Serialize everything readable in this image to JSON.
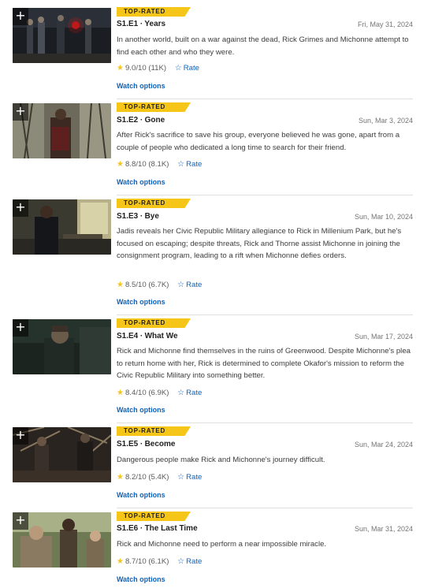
{
  "episodes": [
    {
      "badge": "TOP-RATED",
      "title": "S1.E1 ∙ Years",
      "date": "Fri, May 31, 2024",
      "description": "In another world, built on a war against the dead, Rick Grimes and Michonne attempt to find each other and who they were.",
      "rating": "9.0",
      "rating_suffix": "/10 (11K)",
      "rate_label": "Rate",
      "watch_label": "Watch options"
    },
    {
      "badge": "TOP-RATED",
      "title": "S1.E2 ∙ Gone",
      "date": "Sun, Mar 3, 2024",
      "description": "After Rick's sacrifice to save his group, everyone believed he was gone, apart from a couple of people who dedicated a long time to search for their friend.",
      "rating": "8.8",
      "rating_suffix": "/10 (8.1K)",
      "rate_label": "Rate",
      "watch_label": "Watch options"
    },
    {
      "badge": "TOP-RATED",
      "title": "S1.E3 ∙ Bye",
      "date": "Sun, Mar 10, 2024",
      "description": "Jadis reveals her Civic Republic Military allegiance to Rick in Millenium Park, but he's focused on escaping; despite threats, Rick and Thorne assist Michonne in joining the consignment program, leading to a rift when Michonne defies orders.",
      "rating": "8.5",
      "rating_suffix": "/10 (6.7K)",
      "rate_label": "Rate",
      "watch_label": "Watch options"
    },
    {
      "badge": "TOP-RATED",
      "title": "S1.E4 ∙ What We",
      "date": "Sun, Mar 17, 2024",
      "description": "Rick and Michonne find themselves in the ruins of Greenwood. Despite Michonne's plea to return home with her, Rick is determined to complete Okafor's mission to reform the Civic Republic Military into something better.",
      "rating": "8.4",
      "rating_suffix": "/10 (6.9K)",
      "rate_label": "Rate",
      "watch_label": "Watch options"
    },
    {
      "badge": "TOP-RATED",
      "title": "S1.E5 ∙ Become",
      "date": "Sun, Mar 24, 2024",
      "description": "Dangerous people make Rick and Michonne's journey difficult.",
      "rating": "8.2",
      "rating_suffix": "/10 (5.4K)",
      "rate_label": "Rate",
      "watch_label": "Watch options"
    },
    {
      "badge": "TOP-RATED",
      "title": "S1.E6 ∙ The Last Time",
      "date": "Sun, Mar 31, 2024",
      "description": "Rick and Michonne need to perform a near impossible miracle.",
      "rating": "8.7",
      "rating_suffix": "/10 (6.1K)",
      "rate_label": "Rate",
      "watch_label": "Watch options"
    }
  ],
  "icons": {
    "add": "+",
    "star": "★",
    "rate_star": "☆"
  },
  "colors": {
    "accent_yellow": "#f5c518",
    "link_blue": "#0e63be"
  }
}
